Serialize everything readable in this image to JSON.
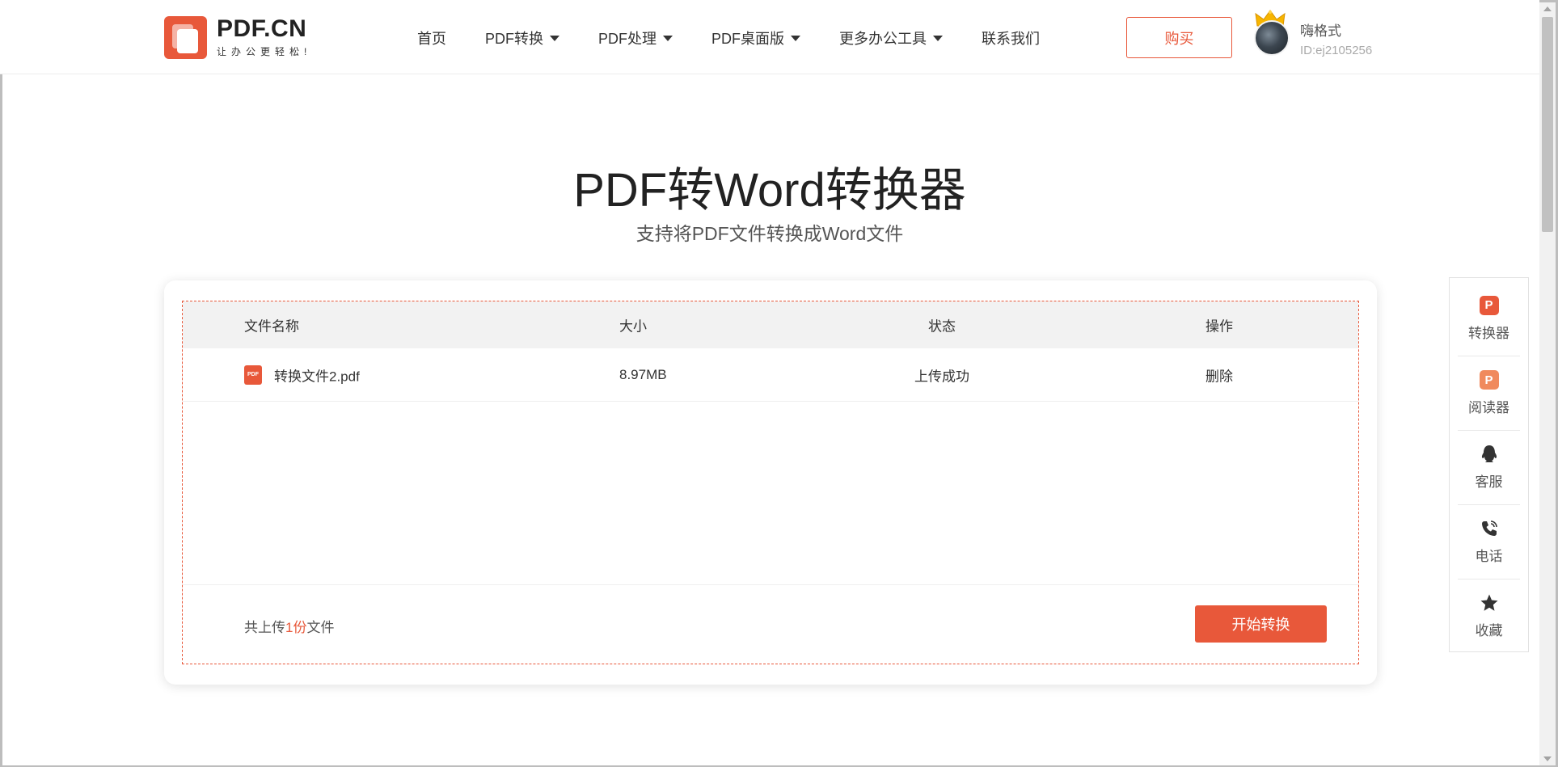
{
  "header": {
    "logo_title": "PDF.CN",
    "logo_slogan": "让办公更轻松!",
    "nav": [
      {
        "label": "首页",
        "dropdown": false
      },
      {
        "label": "PDF转换",
        "dropdown": true
      },
      {
        "label": "PDF处理",
        "dropdown": true
      },
      {
        "label": "PDF桌面版",
        "dropdown": true
      },
      {
        "label": "更多办公工具",
        "dropdown": true
      },
      {
        "label": "联系我们",
        "dropdown": false
      }
    ],
    "buy_label": "购买",
    "user": {
      "name": "嗨格式",
      "id": "ID:ej2105256"
    }
  },
  "hero": {
    "title": "PDF转Word转换器",
    "subtitle": "支持将PDF文件转换成Word文件"
  },
  "table": {
    "columns": {
      "name": "文件名称",
      "size": "大小",
      "status": "状态",
      "op": "操作"
    },
    "rows": [
      {
        "icon": "pdf-file-icon",
        "icon_text": "PDF",
        "name": "转换文件2.pdf",
        "size": "8.97MB",
        "status": "上传成功",
        "op": "删除"
      }
    ],
    "footer": {
      "prefix": "共上传",
      "count": "1份",
      "suffix": "文件",
      "start_label": "开始转换"
    }
  },
  "sidebar": {
    "items": [
      {
        "label": "转换器",
        "icon": "converter-icon"
      },
      {
        "label": "阅读器",
        "icon": "reader-icon"
      },
      {
        "label": "客服",
        "icon": "qq-icon"
      },
      {
        "label": "电话",
        "icon": "phone-icon"
      },
      {
        "label": "收藏",
        "icon": "star-icon"
      }
    ]
  },
  "colors": {
    "accent": "#e8583a",
    "text": "#333333",
    "muted": "#aaaaaa"
  }
}
